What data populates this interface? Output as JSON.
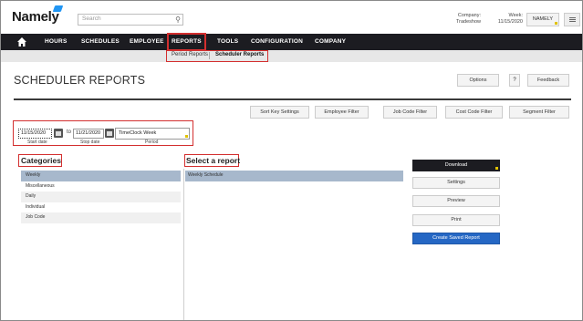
{
  "header": {
    "logo": "Namely",
    "search_placeholder": "Search",
    "company_label": "Company:",
    "company_value": "Tradeshow",
    "week_label": "Week:",
    "week_value": "11/15/2020",
    "namely_button": "NAMELY"
  },
  "nav": {
    "items": [
      "HOURS",
      "SCHEDULES",
      "EMPLOYEE",
      "REPORTS",
      "TOOLS",
      "CONFIGURATION",
      "COMPANY"
    ]
  },
  "subnav": {
    "items": [
      "Period Reports",
      "Scheduler Reports"
    ]
  },
  "page": {
    "title": "SCHEDULER REPORTS",
    "options_button": "Options",
    "help_button": "?",
    "feedback_button": "Feedback"
  },
  "filters": [
    "Sort Key Settings",
    "Employee Filter",
    "Job Code Filter",
    "Cost Code Filter",
    "Segment Filter"
  ],
  "dates": {
    "start_value": "11/15/2020",
    "start_label": "Start date",
    "to_label": "to",
    "stop_value": "11/21/2020",
    "stop_label": "Stop date",
    "period_value": "TimeClock Week",
    "period_label": "Period"
  },
  "categories": {
    "heading": "Categories",
    "items": [
      "Weekly",
      "Miscellaneous",
      "Daily",
      "Individual",
      "Job Code"
    ]
  },
  "reports": {
    "heading": "Select a report",
    "items": [
      "Weekly Schedule"
    ]
  },
  "actions": {
    "download": "Download",
    "settings": "Settings",
    "preview": "Preview",
    "print": "Print",
    "create_saved": "Create Saved Report"
  },
  "colors": {
    "nav_bg": "#1c1c21",
    "highlight_red": "#d32f2f",
    "selected_row": "#a7b8cc",
    "primary_blue": "#2567c4"
  }
}
